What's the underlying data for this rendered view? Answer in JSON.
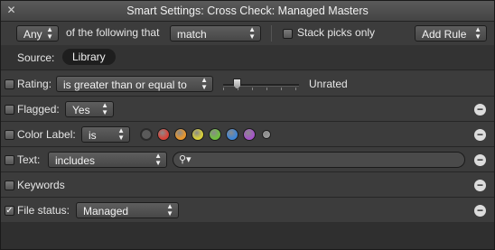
{
  "window": {
    "title": "Smart Settings: Cross Check: Managed Masters",
    "close_icon": "close-icon"
  },
  "toolbar": {
    "match_quantifier": "Any",
    "of_the_following_that": "of the following that",
    "match_mode": "match",
    "stack_picks_label": "Stack picks only",
    "stack_picks_checked": false,
    "add_rule_label": "Add Rule"
  },
  "source": {
    "label": "Source:",
    "value": "Library"
  },
  "rules": {
    "rating": {
      "checked": false,
      "label": "Rating:",
      "operator": "is greater than or equal to",
      "value_label": "Unrated",
      "level": 0
    },
    "flagged": {
      "checked": false,
      "label": "Flagged:",
      "value": "Yes"
    },
    "color_label": {
      "checked": false,
      "label": "Color Label:",
      "operator": "is",
      "colors": [
        "#5a5a5a",
        "#d9443a",
        "#e8962d",
        "#d8cf3a",
        "#6fbf3f",
        "#3f86d6",
        "#a656c8",
        "#9a9a9a"
      ],
      "selected_index": 0
    },
    "text": {
      "checked": false,
      "label": "Text:",
      "operator": "includes",
      "search_value": ""
    },
    "keywords": {
      "checked": false,
      "label": "Keywords"
    },
    "file_status": {
      "checked": true,
      "label": "File status:",
      "value": "Managed"
    }
  },
  "remove_symbol": "−",
  "check_symbol": "✓"
}
